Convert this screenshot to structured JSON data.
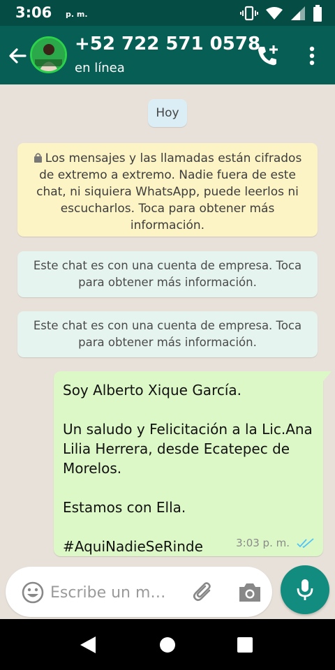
{
  "status_bar": {
    "time": "3:06",
    "ampm": "p. m.",
    "icons": [
      "vibrate-icon",
      "wifi-icon",
      "signal-icon",
      "battery-icon"
    ]
  },
  "header": {
    "contact_name": "+52 722 571 0578",
    "contact_status": "en línea",
    "icons": [
      "back-arrow-icon",
      "avatar",
      "add-call-icon",
      "more-vert-icon"
    ]
  },
  "chat": {
    "date_chip": "Hoy",
    "encryption_notice": "Los mensajes y las llamadas están cifrados de extremo a extremo. Nadie fuera de este chat, ni siquiera WhatsApp, puede leerlos ni escucharlos. Toca para obtener más información.",
    "business_notices": [
      "Este chat es con una cuenta de empresa. Toca para obtener más información.",
      "Este chat es con una cuenta de empresa. Toca para obtener más información."
    ],
    "messages": [
      {
        "text": "Soy Alberto Xique García.\n\nUn saludo y Felicitación a la Lic.Ana Lilia Herrera, desde Ecatepec de Morelos.\n\nEstamos con Ella.\n\n#AquiNadieSeRinde",
        "time": "3:03 p. m.",
        "status": "read"
      }
    ]
  },
  "composer": {
    "placeholder": "Escribe un m…",
    "icons": [
      "emoji-icon",
      "attach-icon",
      "camera-icon",
      "mic-icon"
    ]
  },
  "colors": {
    "header": "#075e54",
    "status_bar": "#054d44",
    "outgoing_bubble": "#dcf8c6",
    "encryption_bubble": "#fdf4c5",
    "business_bubble": "#e6f4ef",
    "fab": "#128c7e",
    "read_ticks": "#4fc3f7"
  }
}
